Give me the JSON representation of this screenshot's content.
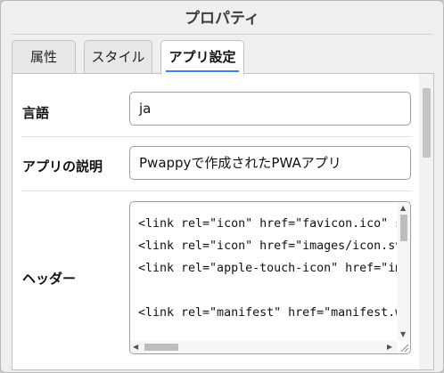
{
  "window": {
    "title": "プロパティ"
  },
  "tabs": [
    {
      "label": "属性",
      "active": false
    },
    {
      "label": "スタイル",
      "active": false
    },
    {
      "label": "アプリ設定",
      "active": true
    }
  ],
  "settings": {
    "language": {
      "label": "言語",
      "value": "ja"
    },
    "description": {
      "label": "アプリの説明",
      "value": "Pwappyで作成されたPWAアプリ"
    },
    "header": {
      "label": "ヘッダー",
      "lines": [
        "<link rel=\"icon\" href=\"favicon.ico\" sizes=\"any\">",
        "<link rel=\"icon\" href=\"images/icon.svg\" type=\"image/svg+xml\">",
        "<link rel=\"apple-touch-icon\" href=\"images/apple-touch-icon.png\">",
        "",
        "<link rel=\"manifest\" href=\"manifest.webmanifest\">"
      ]
    }
  },
  "colors": {
    "accent": "#3b82f6",
    "panel_bg": "#ffffff",
    "window_bg": "#efefef"
  },
  "icons": {
    "scroll_up": "arrow-up-icon",
    "scroll_down": "arrow-down-icon",
    "scroll_left": "arrow-left-icon",
    "scroll_right": "arrow-right-icon",
    "resize": "resize-grip-icon"
  }
}
